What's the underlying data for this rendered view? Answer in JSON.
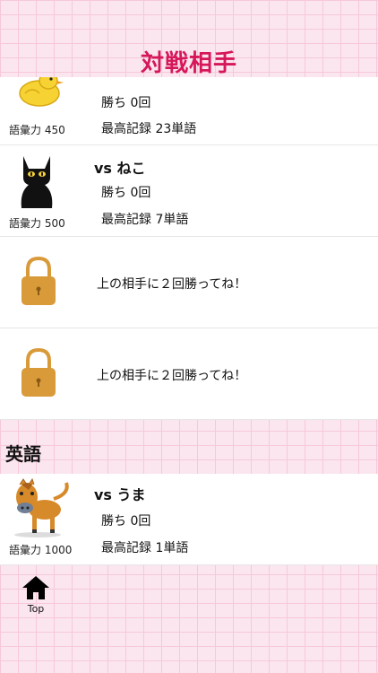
{
  "header": {
    "title": "対戦相手"
  },
  "opponents": [
    {
      "vocab": "語彙力 450",
      "wins": "勝ち 0回",
      "record": "最高記録 23単語"
    },
    {
      "name": "vs ねこ",
      "vocab": "語彙力 500",
      "wins": "勝ち 0回",
      "record": "最高記録 7単語"
    }
  ],
  "locked": [
    {
      "message": "上の相手に２回勝ってね！"
    },
    {
      "message": "上の相手に２回勝ってね！"
    }
  ],
  "section": {
    "title": "英語"
  },
  "english_opponents": [
    {
      "name": "vs うま",
      "vocab": "語彙力 1000",
      "wins": "勝ち 0回",
      "record": "最高記録 1単語"
    }
  ],
  "tabbar": {
    "top_label": "Top"
  },
  "colors": {
    "title": "#d6175a",
    "lock": "#d99a3a",
    "bird": "#f6d233",
    "cat": "#111111",
    "horse": "#d78a2a"
  }
}
